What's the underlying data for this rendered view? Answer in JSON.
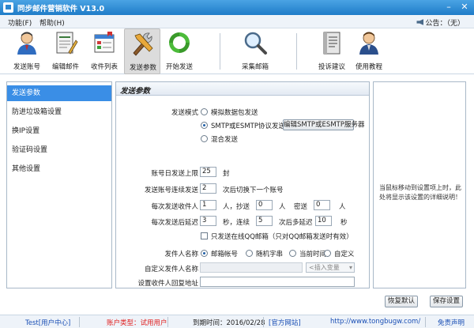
{
  "window": {
    "title": "同步邮件营销软件    V13.0",
    "min": "–",
    "close": "✕"
  },
  "menu": {
    "items": [
      "功能(F)",
      "帮助(H)"
    ],
    "notice": "公告：（无）"
  },
  "toolbar": {
    "items": [
      {
        "label": "发送账号",
        "icon": "account-person-icon"
      },
      {
        "label": "编辑邮件",
        "icon": "edit-mail-icon"
      },
      {
        "label": "收件列表",
        "icon": "recipient-list-icon"
      },
      {
        "label": "发送参数",
        "icon": "tools-wrench-icon"
      },
      {
        "label": "开始发送",
        "icon": "start-send-icon"
      },
      {
        "label": "采集邮箱",
        "icon": "magnifier-icon"
      },
      {
        "label": "投诉建议",
        "icon": "complaint-book-icon"
      },
      {
        "label": "使用教程",
        "icon": "tutorial-person-icon"
      }
    ],
    "active_index": 3
  },
  "sidebar": {
    "items": [
      "发送参数",
      "防进垃圾箱设置",
      "换IP设置",
      "验证码设置",
      "其他设置"
    ],
    "active_index": 0
  },
  "panel": {
    "title": "发送参数",
    "mode_label": "发送模式",
    "modes": [
      "模拟数据包发送",
      "SMTP或ESMTP协议发送",
      "混合发送"
    ],
    "mode_selected": 1,
    "edit_server_button": "编辑SMTP或ESMTP服务器",
    "daily_limit": {
      "label": "账号日发送上限",
      "value": "25",
      "unit": "封"
    },
    "continuous": {
      "label": "发送账号连续发送",
      "value": "2",
      "suffix": "次后切换下一个账号"
    },
    "per_send": {
      "label": "每次发送收件人",
      "count": "1",
      "unit1": "人，抄送",
      "cc": "0",
      "unit2": "人",
      "bcc_label": "密送",
      "bcc": "0",
      "unit3": "人"
    },
    "delay": {
      "label": "每次发送后延迟",
      "v1": "3",
      "t1": "秒，连续",
      "v2": "5",
      "t2": "次后多延迟",
      "v3": "10",
      "t3": "秒"
    },
    "qq_only": "只发送在线QQ邮箱（只对QQ邮箱发送时有效）",
    "sender_name": {
      "label": "发件人名称",
      "options": [
        "邮箱帐号",
        "随机字串",
        "当前时间",
        "自定义"
      ],
      "selected": 0
    },
    "custom_sender": {
      "label": "自定义发件人名称",
      "select_placeholder": "<插入变量",
      "arrow": "▾"
    },
    "reply_addr": {
      "label": "设置收件人回复地址",
      "value": ""
    }
  },
  "help": {
    "text": "当鼠标移动到设置项上时，此处将显示该设置的详细说明！"
  },
  "buttons": {
    "restore_default": "恢复默认",
    "save": "保存设置"
  },
  "status": {
    "user": "Test[用户中心]",
    "account_type": "账户类型：试用用户",
    "expire": "到期时间：2016/02/28",
    "website_label": "[官方网站]",
    "website_url": "http://www.tongbugw.com/",
    "disclaimer": "免责声明"
  },
  "colors": {
    "titlebar": "#1f7cc8",
    "sidebar_active": "#3a8ee6",
    "account_type_text": "#e02020",
    "website_text": "#1a4fb5"
  }
}
